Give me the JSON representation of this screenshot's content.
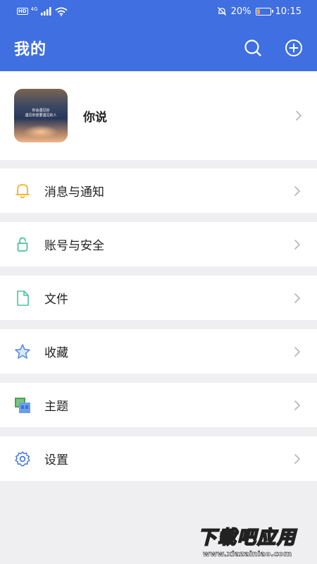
{
  "status_bar": {
    "hd": "HD",
    "network": "4G",
    "battery_text": "20%",
    "battery_level": 0.2,
    "time": "10:15",
    "battery_color": "#f7a431"
  },
  "header": {
    "title": "我的",
    "background": "#3f6fe0",
    "icons": [
      "search-icon",
      "add-circle-icon"
    ]
  },
  "profile": {
    "name": "你说",
    "avatar_text_line1": "你会遇见好",
    "avatar_text_line2": "遇见你想要遇见的人"
  },
  "menu": {
    "items": [
      {
        "label": "消息与通知",
        "icon": "bell-icon",
        "color": "#f2b51c"
      },
      {
        "label": "账号与安全",
        "icon": "lock-icon",
        "color": "#4bc3a0"
      },
      {
        "label": "文件",
        "icon": "file-icon",
        "color": "#4bc3a0"
      },
      {
        "label": "收藏",
        "icon": "star-icon",
        "color": "#5a8ae6"
      },
      {
        "label": "主题",
        "icon": "theme-icon",
        "color": "#4a9f5a"
      },
      {
        "label": "设置",
        "icon": "gear-icon",
        "color": "#3f6fe0"
      }
    ]
  },
  "watermark": {
    "title": "下载吧应用",
    "url": "www.xiazainiao.com"
  }
}
